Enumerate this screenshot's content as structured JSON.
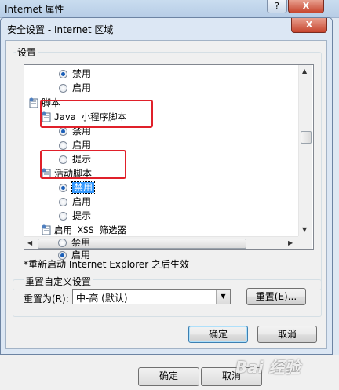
{
  "parent_window": {
    "title": "Internet 属性",
    "help_glyph": "?",
    "close_glyph": "X",
    "ok_label": "确定",
    "cancel_label": "取消",
    "watermark": "Bai 经验"
  },
  "dialog": {
    "title": "安全设置 - Internet 区域",
    "close_glyph": "X",
    "settings_label": "设置",
    "tree": [
      {
        "kind": "radio",
        "label": "禁用",
        "checked": true
      },
      {
        "kind": "radio",
        "label": "启用",
        "checked": false
      },
      {
        "kind": "category",
        "label": "脚本"
      },
      {
        "kind": "setting",
        "label": "Java 小程序脚本"
      },
      {
        "kind": "radio",
        "label": "禁用",
        "checked": true
      },
      {
        "kind": "radio",
        "label": "启用",
        "checked": false
      },
      {
        "kind": "radio",
        "label": "提示",
        "checked": false
      },
      {
        "kind": "setting",
        "label": "活动脚本"
      },
      {
        "kind": "radio",
        "label": "禁用",
        "checked": true,
        "selected": true
      },
      {
        "kind": "radio",
        "label": "启用",
        "checked": false
      },
      {
        "kind": "radio",
        "label": "提示",
        "checked": false
      },
      {
        "kind": "setting",
        "label": "启用 XSS 筛选器"
      },
      {
        "kind": "radio",
        "label": "禁用",
        "checked": false
      },
      {
        "kind": "radio",
        "label": "启用",
        "checked": true
      }
    ],
    "restart_note": "*重新启动 Internet Explorer 之后生效",
    "reset_group_title": "重置自定义设置",
    "reset_to_label": "重置为(R):",
    "reset_level_value": "中-高 (默认)",
    "reset_button_label": "重置(E)...",
    "ok_label": "确定",
    "cancel_label": "取消"
  },
  "colors": {
    "highlight_box": "#e0202a",
    "selection": "#3399ff",
    "radio_dot": "#1b5fb8"
  }
}
